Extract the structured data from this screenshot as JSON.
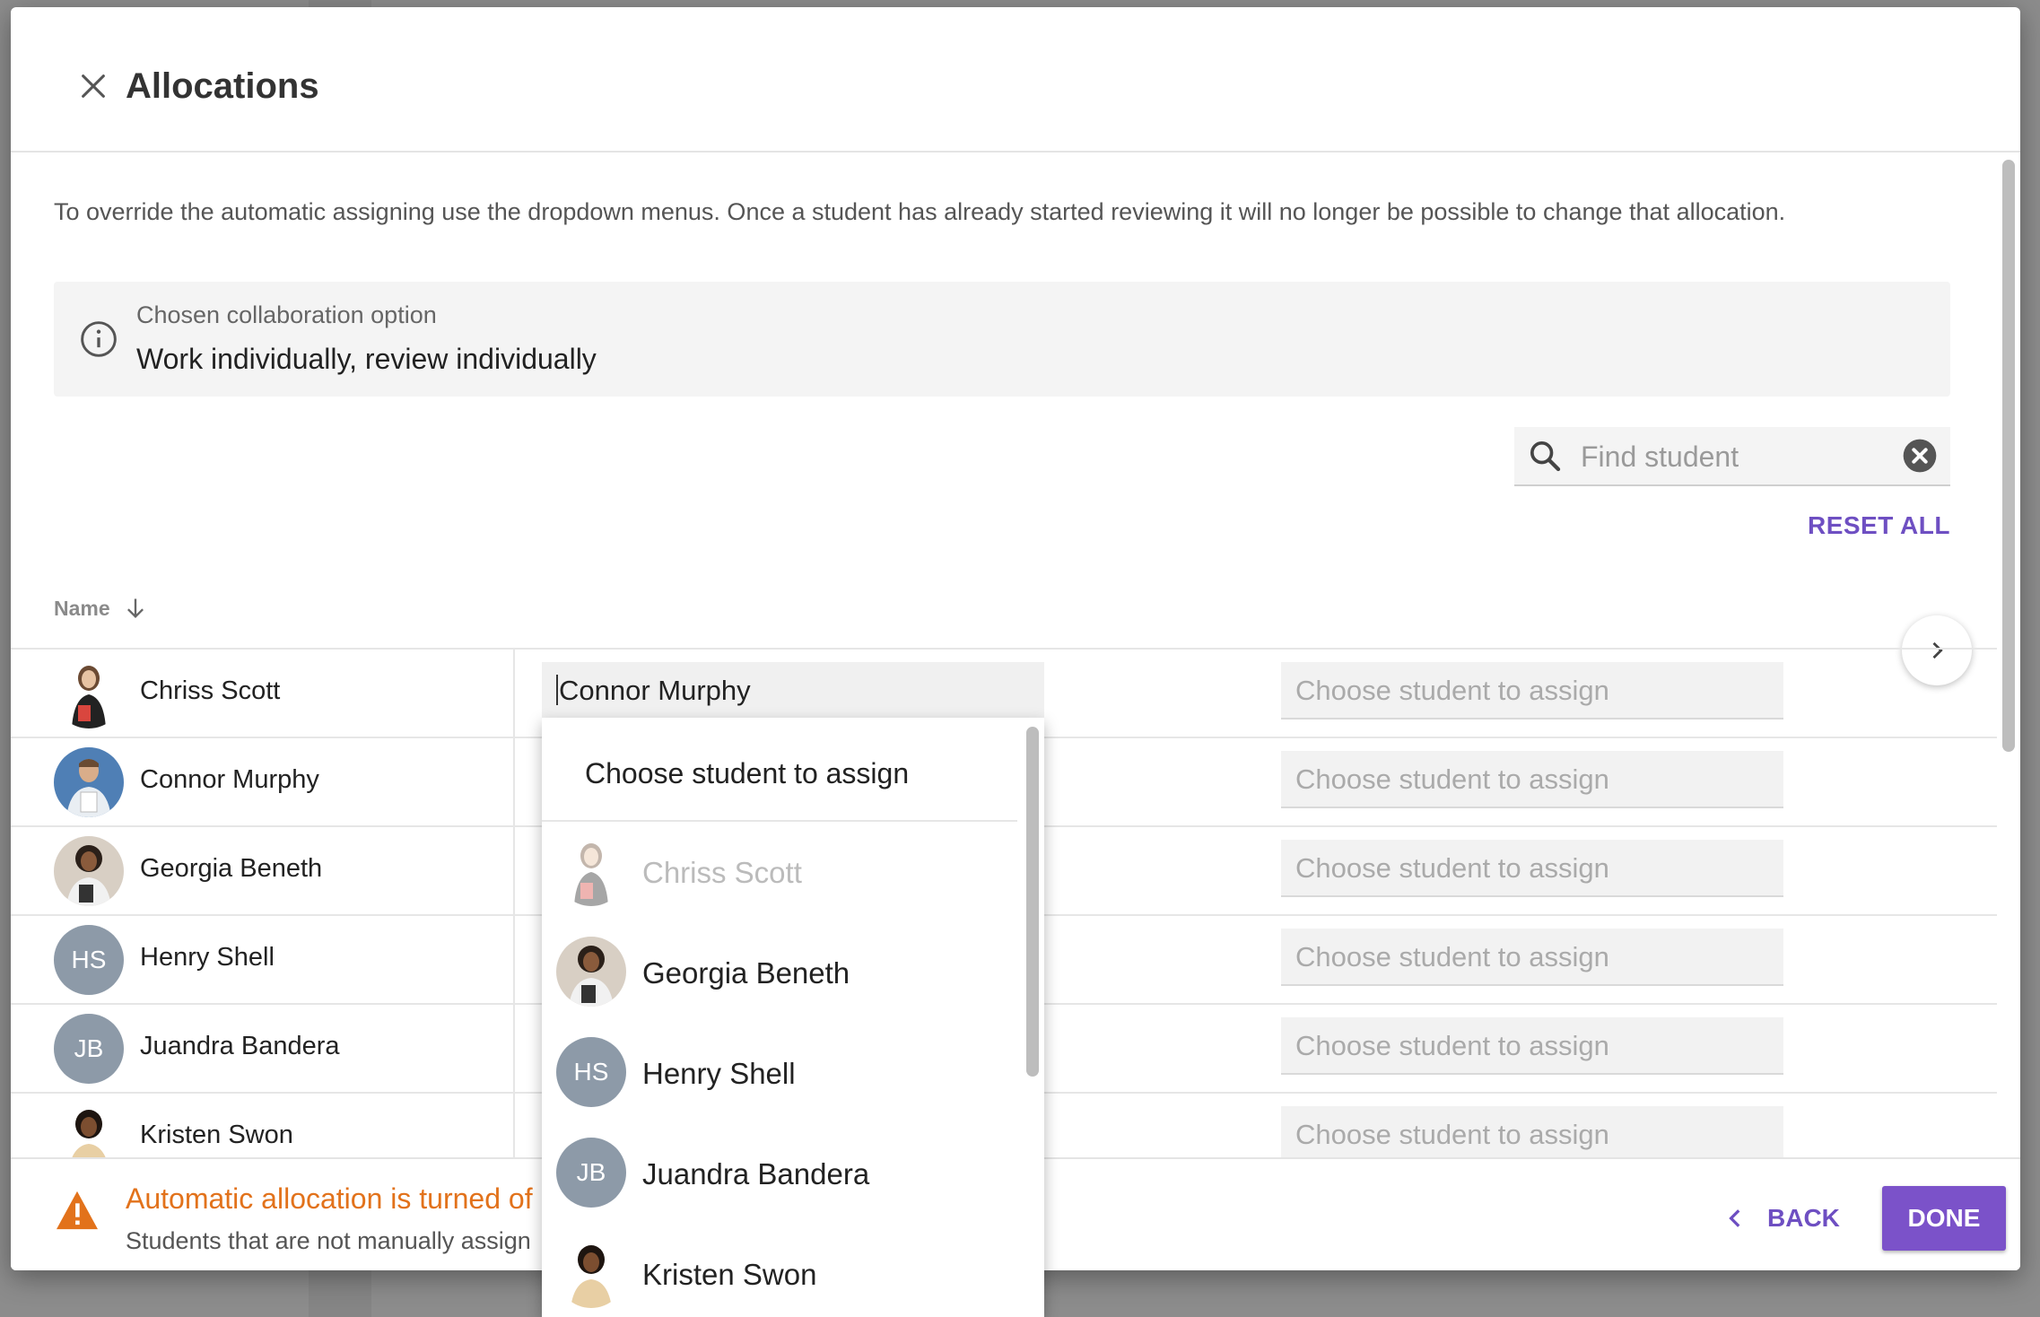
{
  "dialog": {
    "title": "Allocations",
    "intro": "To override the automatic assigning use the dropdown menus. Once a student has already started reviewing it will no longer be possible to change that allocation.",
    "info": {
      "label": "Chosen collaboration option",
      "value": "Work individually, review individually"
    },
    "search": {
      "placeholder": "Find student",
      "value": ""
    },
    "reset_all": "RESET ALL",
    "column_name": "Name"
  },
  "rows": [
    {
      "name": "Chriss Scott",
      "avatar": "photo",
      "assign1": "Connor Murphy",
      "assign2": "Choose student to assign"
    },
    {
      "name": "Connor Murphy",
      "avatar": "photo",
      "assign1": "",
      "assign2": "Choose student to assign"
    },
    {
      "name": "Georgia Beneth",
      "avatar": "photo",
      "assign1": "",
      "assign2": "Choose student to assign"
    },
    {
      "name": "Henry Shell",
      "avatar": "HS",
      "assign1": "",
      "assign2": "Choose student to assign"
    },
    {
      "name": "Juandra Bandera",
      "avatar": "JB",
      "assign1": "",
      "assign2": "Choose student to assign"
    },
    {
      "name": "Kristen Swon",
      "avatar": "photo",
      "assign1": "",
      "assign2": "Choose student to assign"
    }
  ],
  "dropdown": {
    "header": "Choose student to assign",
    "items": [
      {
        "name": "Chriss Scott",
        "initials": "",
        "disabled": true
      },
      {
        "name": "Georgia Beneth",
        "initials": ""
      },
      {
        "name": "Henry Shell",
        "initials": "HS"
      },
      {
        "name": "Juandra Bandera",
        "initials": "JB"
      },
      {
        "name": "Kristen Swon",
        "initials": ""
      }
    ]
  },
  "footer": {
    "warning_title": "Automatic allocation is turned of",
    "warning_sub": "Students that are not manually assign",
    "back": "BACK",
    "done": "DONE"
  },
  "colors": {
    "accent": "#7b52c9",
    "warning": "#e2721b",
    "avatar_initials_bg": "#8d9aa8"
  }
}
